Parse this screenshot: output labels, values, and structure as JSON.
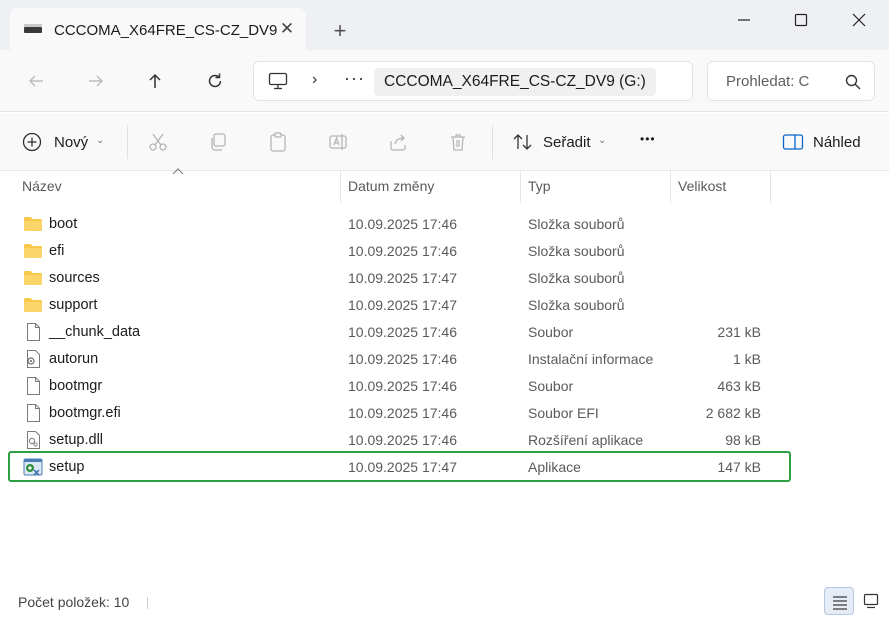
{
  "window": {
    "tab_title": "CCCOMA_X64FRE_CS-CZ_DV9",
    "tab_close_glyph": "✕",
    "new_tab_glyph": "+"
  },
  "address": {
    "chevron": "›",
    "overflow": "···",
    "crumb": "CCCOMA_X64FRE_CS-CZ_DV9 (G:)"
  },
  "search": {
    "placeholder": "Prohledat: C"
  },
  "toolbar": {
    "new_label": "Nový",
    "sort_label": "Seřadit",
    "preview_label": "Náhled",
    "more_glyph": "•••",
    "caret": "⌄"
  },
  "columns": {
    "name": "Název",
    "date": "Datum změny",
    "type": "Typ",
    "size": "Velikost"
  },
  "files": [
    {
      "name": "boot",
      "date": "10.09.2025 17:46",
      "type": "Složka souborů",
      "size": "",
      "icon": "folder-icon"
    },
    {
      "name": "efi",
      "date": "10.09.2025 17:46",
      "type": "Složka souborů",
      "size": "",
      "icon": "folder-icon"
    },
    {
      "name": "sources",
      "date": "10.09.2025 17:47",
      "type": "Složka souborů",
      "size": "",
      "icon": "folder-icon"
    },
    {
      "name": "support",
      "date": "10.09.2025 17:47",
      "type": "Složka souborů",
      "size": "",
      "icon": "folder-icon"
    },
    {
      "name": "__chunk_data",
      "date": "10.09.2025 17:46",
      "type": "Soubor",
      "size": "231 kB",
      "icon": "file-icon"
    },
    {
      "name": "autorun",
      "date": "10.09.2025 17:46",
      "type": "Instalační informace",
      "size": "1 kB",
      "icon": "setup-info-icon"
    },
    {
      "name": "bootmgr",
      "date": "10.09.2025 17:46",
      "type": "Soubor",
      "size": "463 kB",
      "icon": "file-icon"
    },
    {
      "name": "bootmgr.efi",
      "date": "10.09.2025 17:46",
      "type": "Soubor EFI",
      "size": "2 682 kB",
      "icon": "file-icon"
    },
    {
      "name": "setup.dll",
      "date": "10.09.2025 17:46",
      "type": "Rozšíření aplikace",
      "size": "98 kB",
      "icon": "dll-icon"
    },
    {
      "name": "setup",
      "date": "10.09.2025 17:47",
      "type": "Aplikace",
      "size": "147 kB",
      "icon": "setup-app-icon",
      "highlighted": true
    }
  ],
  "status": {
    "item_count": "Počet položek: 10"
  },
  "colors": {
    "highlight": "#2ea043",
    "folder": "#f8c84a",
    "accent": "#0a64c8"
  }
}
